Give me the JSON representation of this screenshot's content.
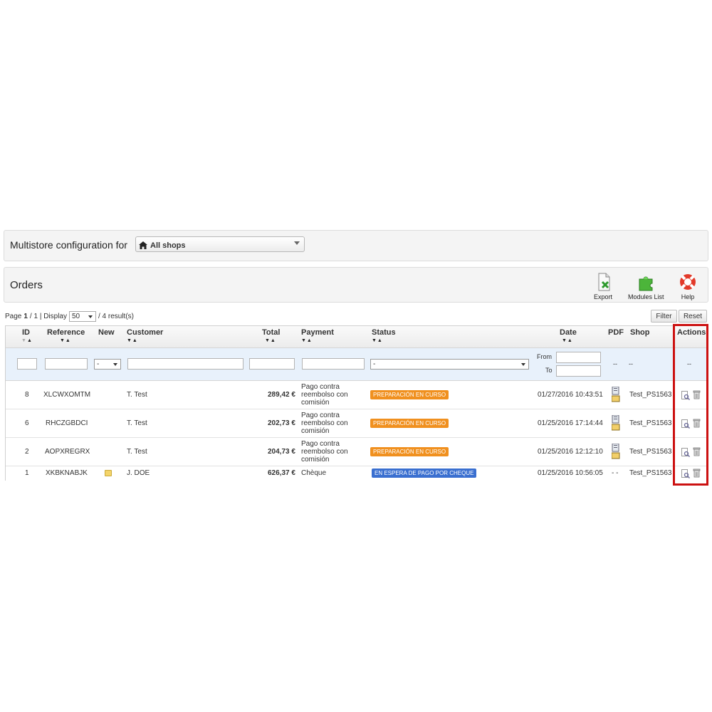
{
  "multistore": {
    "label": "Multistore configuration for",
    "selected_shop": "All shops"
  },
  "orders": {
    "title": "Orders",
    "toolbar": {
      "export": "Export",
      "modules_list": "Modules List",
      "help": "Help"
    }
  },
  "pagination": {
    "page_word": "Page",
    "current": "1",
    "of_total": "/ 1 | Display",
    "display_value": "50",
    "results": "/ 4 result(s)"
  },
  "buttons": {
    "filter": "Filter",
    "reset": "Reset"
  },
  "table": {
    "headers": {
      "id": "ID",
      "reference": "Reference",
      "new": "New",
      "customer": "Customer",
      "total": "Total",
      "payment": "Payment",
      "status": "Status",
      "date": "Date",
      "pdf": "PDF",
      "shop": "Shop",
      "actions": "Actions"
    },
    "filters": {
      "new_value": "-",
      "status_value": "-",
      "from_label": "From",
      "to_label": "To",
      "pdf_value": "--",
      "shop_value": "--",
      "actions_value": "--"
    },
    "rows": [
      {
        "id": "8",
        "reference": "XLCWXOMTM",
        "customer": "T. Test",
        "total": "289,42 €",
        "payment": "Pago contra reembolso con comisión",
        "status": "PREPARACIÓN EN CURSO",
        "date": "01/27/2016 10:43:51",
        "shop": "Test_PS1563"
      },
      {
        "id": "6",
        "reference": "RHCZGBDCI",
        "customer": "T. Test",
        "total": "202,73 €",
        "payment": "Pago contra reembolso con comisión",
        "status": "PREPARACIÓN EN CURSO",
        "date": "01/25/2016 17:14:44",
        "shop": "Test_PS1563"
      },
      {
        "id": "2",
        "reference": "AOPXREGRX",
        "customer": "T. Test",
        "total": "204,73 €",
        "payment": "Pago contra reembolso con comisión",
        "status": "PREPARACIÓN EN CURSO",
        "date": "01/25/2016 12:12:10",
        "shop": "Test_PS1563"
      },
      {
        "id": "1",
        "reference": "XKBKNABJK",
        "customer": "J. DOE",
        "total": "626,37 €",
        "payment": "Chèque",
        "status": "EN ESPERA DE PAGO POR CHEQUE",
        "date": "01/25/2016 10:56:05",
        "pdf": "- -",
        "shop": "Test_PS1563"
      }
    ]
  },
  "colors": {
    "status_preparing": "#f0901f",
    "status_awaiting_check": "#3a6fd0",
    "highlight": "#cc1111"
  },
  "icons": {
    "export": "export-icon",
    "modules": "puzzle-icon",
    "help": "lifebuoy-icon",
    "view": "view-icon",
    "delete": "trash-icon",
    "pdf": "invoice-icon",
    "new": "new-order-icon"
  }
}
